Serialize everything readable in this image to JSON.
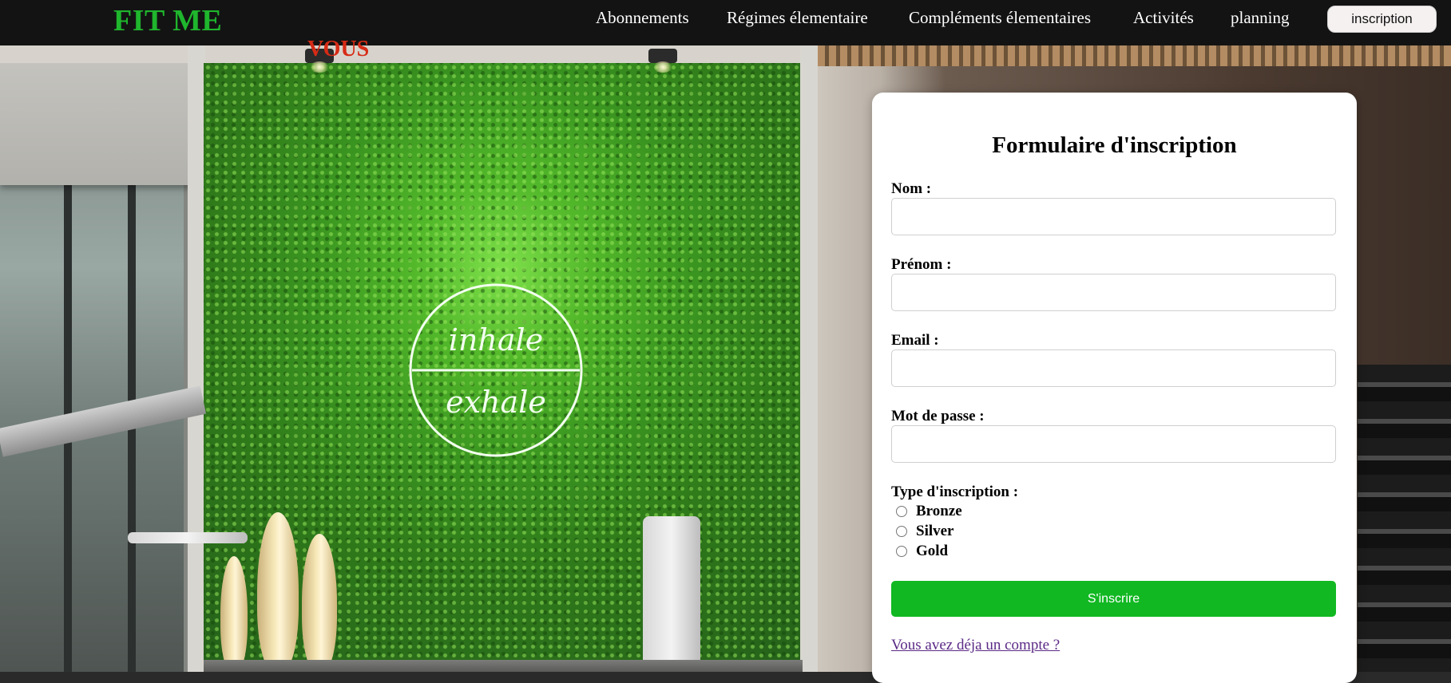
{
  "header": {
    "logo": "FIT ME",
    "nav": {
      "abonnements": "Abonnements",
      "regimes": "Régimes élementaire",
      "complements": "Compléments élementaires",
      "activites": "Activités",
      "planning": "planning"
    },
    "inscription_button": "inscription"
  },
  "hero": {
    "accent_word": "VOUS",
    "neon_line1": "inhale",
    "neon_line2": "exhale"
  },
  "form": {
    "title": "Formulaire d'inscription",
    "nom_label": "Nom :",
    "prenom_label": "Prénom :",
    "email_label": "Email :",
    "password_label": "Mot de passe :",
    "type_label": "Type d'inscription :",
    "options": {
      "bronze": "Bronze",
      "silver": "Silver",
      "gold": "Gold"
    },
    "submit": "S'inscrire",
    "login_link": "Vous avez déja un compte ?"
  },
  "colors": {
    "navbar_bg": "#131313",
    "logo": "#1fb52d",
    "accent_word": "#d72b16",
    "submit_bg": "#11b822",
    "link": "#5b2a86"
  }
}
